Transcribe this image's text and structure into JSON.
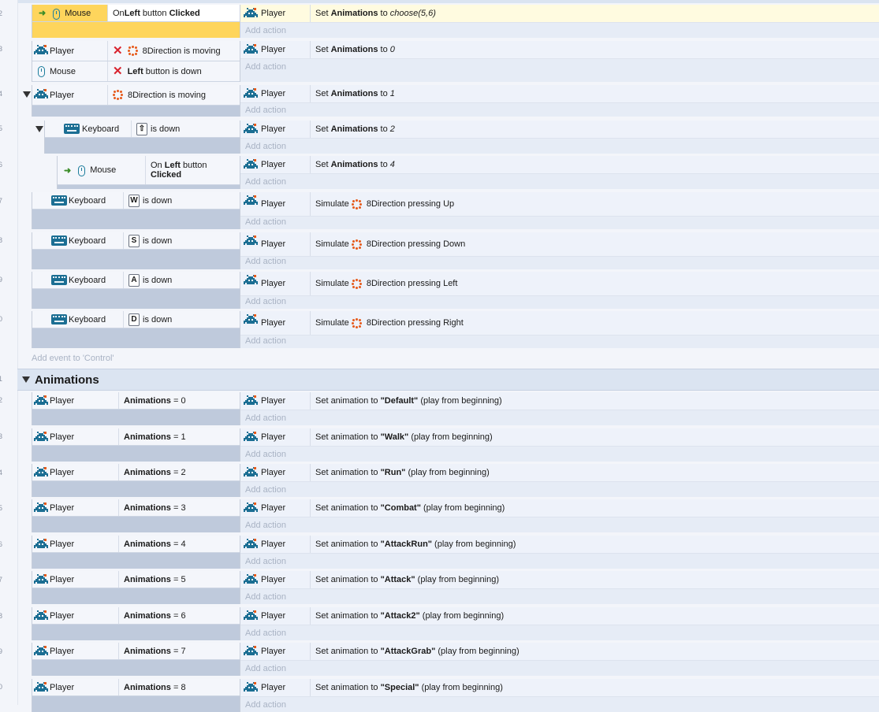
{
  "line_numbers": [
    "2",
    "3",
    "4",
    "5",
    "6",
    "7",
    "8",
    "9",
    "0",
    "1",
    "2",
    "3",
    "4",
    "5",
    "6",
    "7",
    "8",
    "9",
    "0"
  ],
  "objects": {
    "player": "Player",
    "mouse": "Mouse",
    "keyboard": "Keyboard"
  },
  "add_action_label": "Add action",
  "add_event_label": "Add event to 'Control'",
  "group_title": "Animations",
  "ev2": {
    "cond_a": "On ",
    "cond_b": "Left",
    "cond_c": " button ",
    "cond_d": "Clicked",
    "act_a": "Set ",
    "act_b": "Animations",
    "act_c": " to ",
    "act_d": "choose(5,6)"
  },
  "ev3": {
    "cond1": "8Direction is moving",
    "cond2a": "Left",
    "cond2b": " button is down",
    "act_a": "Set ",
    "act_b": "Animations",
    "act_c": " to ",
    "act_d": "0"
  },
  "ev4": {
    "cond": "8Direction is moving",
    "act_a": "Set ",
    "act_b": "Animations",
    "act_c": " to ",
    "act_d": "1"
  },
  "ev5": {
    "key": "⇧",
    "cond": "is down",
    "act_a": "Set ",
    "act_b": "Animations",
    "act_c": " to ",
    "act_d": "2"
  },
  "ev6": {
    "cond_a": "On ",
    "cond_b": "Left",
    "cond_c": " button",
    "cond_d": "Clicked",
    "act_a": "Set ",
    "act_b": "Animations",
    "act_c": " to ",
    "act_d": "4"
  },
  "keys": [
    {
      "key": "W",
      "cond": "is down",
      "act_a": "Simulate ",
      "act_b": "8Direction pressing Up"
    },
    {
      "key": "S",
      "cond": "is down",
      "act_a": "Simulate ",
      "act_b": "8Direction pressing Down"
    },
    {
      "key": "A",
      "cond": "is down",
      "act_a": "Simulate ",
      "act_b": "8Direction pressing Left"
    },
    {
      "key": "D",
      "cond": "is down",
      "act_a": "Simulate ",
      "act_b": "8Direction pressing Right"
    }
  ],
  "anims": [
    {
      "var": "Animations",
      "op": " = ",
      "val": "0",
      "a": "Set animation to ",
      "name": "\"Default\"",
      "b": " (play from beginning)"
    },
    {
      "var": "Animations",
      "op": " = ",
      "val": "1",
      "a": "Set animation to ",
      "name": "\"Walk\"",
      "b": " (play from beginning)"
    },
    {
      "var": "Animations",
      "op": " = ",
      "val": "2",
      "a": "Set animation to ",
      "name": "\"Run\"",
      "b": " (play from beginning)"
    },
    {
      "var": "Animations",
      "op": " = ",
      "val": "3",
      "a": "Set animation to ",
      "name": "\"Combat\"",
      "b": " (play from beginning)"
    },
    {
      "var": "Animations",
      "op": " = ",
      "val": "4",
      "a": "Set animation to ",
      "name": "\"AttackRun\"",
      "b": " (play from beginning)"
    },
    {
      "var": "Animations",
      "op": " = ",
      "val": "5",
      "a": "Set animation to ",
      "name": "\"Attack\"",
      "b": " (play from beginning)"
    },
    {
      "var": "Animations",
      "op": " = ",
      "val": "6",
      "a": "Set animation to ",
      "name": "\"Attack2\"",
      "b": " (play from beginning)"
    },
    {
      "var": "Animations",
      "op": " = ",
      "val": "7",
      "a": "Set animation to ",
      "name": "\"AttackGrab\"",
      "b": " (play from beginning)"
    },
    {
      "var": "Animations",
      "op": " = ",
      "val": "8",
      "a": "Set animation to ",
      "name": "\"Special\"",
      "b": " (play from beginning)"
    }
  ],
  "colors": {
    "selected": "#fed55c",
    "condition_bg": "#bfcadc",
    "action_bg": "#e6ecf6",
    "invader": "#1b6e93",
    "direction": "#e65a1b"
  }
}
